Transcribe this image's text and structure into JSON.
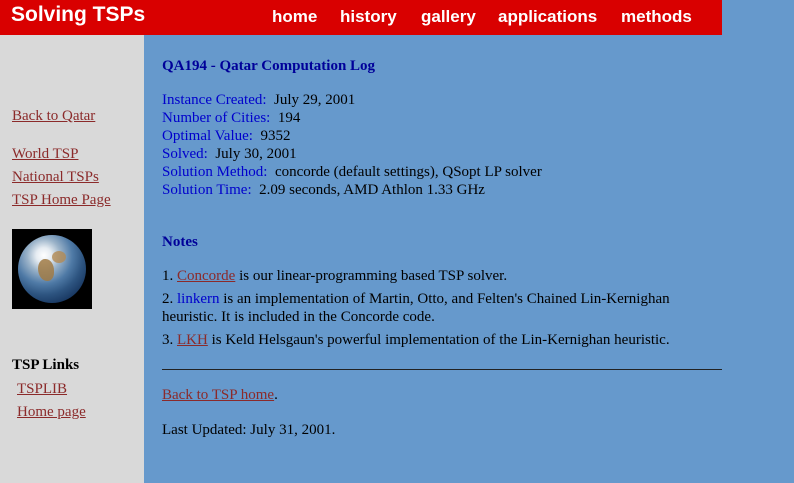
{
  "header": {
    "site_title": "Solving TSPs",
    "nav": [
      "home",
      "history",
      "gallery",
      "applications",
      "methods"
    ]
  },
  "sidebar": {
    "back_link": "Back to Qatar",
    "links": [
      "World TSP",
      "National TSPs",
      "TSP Home Page"
    ],
    "links_heading": "TSP Links",
    "tsp_links": [
      "TSPLIB",
      "Home page"
    ]
  },
  "main": {
    "title": "QA194 - Qatar Computation Log",
    "info": [
      {
        "key": "Instance Created:",
        "value": "July 29, 2001"
      },
      {
        "key": "Number of Cities:",
        "value": "194"
      },
      {
        "key": "Optimal Value:",
        "value": "9352"
      },
      {
        "key": "Solved:",
        "value": "July 30, 2001"
      },
      {
        "key": "Solution Method:",
        "value": "concorde (default settings), QSopt LP solver"
      },
      {
        "key": "Solution Time:",
        "value": "2.09 seconds, AMD Athlon 1.33 GHz"
      }
    ],
    "notes_title": "Notes",
    "notes": [
      {
        "num": "1.",
        "link": "Concorde",
        "text": " is our linear-programming based TSP solver."
      },
      {
        "num": "2.",
        "link": "linkern",
        "text": " is an implementation of Martin, Otto, and Felten's Chained Lin-Kernighan",
        "text2": "heuristic. It is included in the Concorde code."
      },
      {
        "num": "3.",
        "link": "LKH",
        "text": " is Keld Helsgaun's powerful implementation of the Lin-Kernighan heuristic."
      }
    ],
    "back_home_link": "Back to TSP home",
    "back_home_suffix": ".",
    "last_updated": "Last Updated:  July 31, 2001."
  },
  "colors": {
    "header_bg": "#d90000",
    "main_bg": "#6699cc",
    "sidebar_bg": "#d9d9d9",
    "link": "#8b2a2a",
    "label": "#0000cc"
  }
}
